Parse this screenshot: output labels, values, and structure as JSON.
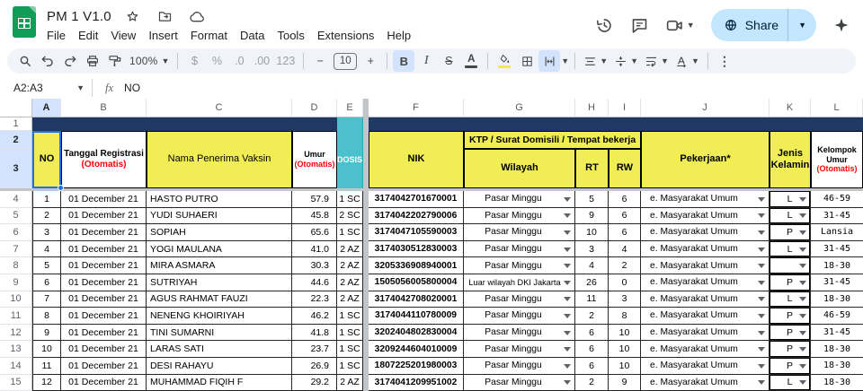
{
  "header": {
    "title": "PM 1 V1.0",
    "menus": [
      "File",
      "Edit",
      "View",
      "Insert",
      "Format",
      "Data",
      "Tools",
      "Extensions",
      "Help"
    ],
    "share_label": "Share"
  },
  "toolbar": {
    "zoom_level": "100%",
    "currency_label": "$",
    "percent_label": "%",
    "decimal_decrease_label": ".0",
    "decimal_increase_label": ".00",
    "number_format_label": "123",
    "minus_label": "−",
    "font_size": "10",
    "plus_label": "+",
    "bold_label": "B",
    "italic_label": "I",
    "strikethrough_label": "S",
    "text_color_label": "A",
    "more_label": "⋮"
  },
  "formula_bar": {
    "cell_reference": "A2:A3",
    "fx_label": "fx",
    "formula_value": "NO"
  },
  "sheet": {
    "column_letters": [
      "A",
      "B",
      "C",
      "D",
      "E",
      "F",
      "G",
      "H",
      "I",
      "J",
      "K",
      "L"
    ],
    "frozen_row_numbers": [
      "1",
      "2",
      "3"
    ],
    "headers": {
      "no": "NO",
      "tanggal_registrasi": "Tanggal Registrasi",
      "tanggal_registrasi_note": "(Otomatis)",
      "nama_penerima_vaksin": "Nama Penerima Vaksin",
      "umur": "Umur",
      "umur_note": "(Otomatis)",
      "dosis": "DOSIS",
      "nik": "NIK",
      "ktp_group": "KTP / Surat Domisili / Tempat bekerja",
      "wilayah": "Wilayah",
      "rt": "RT",
      "rw": "RW",
      "pekerjaan": "Pekerjaan*",
      "jenis_kelamin": "Jenis Kelamin",
      "kelompok_umur": "Kelompok Umur",
      "kelompok_umur_note": "(Otomatis)"
    },
    "rows": [
      {
        "row_number": "4",
        "no": "1",
        "tanggal": "01 December 21",
        "nama": "HASTO PUTRO",
        "umur": "57.9",
        "dosis": "1 SC",
        "nik": "3174042701670001",
        "wilayah": "Pasar Minggu",
        "rt": "5",
        "rw": "6",
        "pekerjaan": "e. Masyarakat Umum",
        "jenis_kelamin": "L",
        "kelompok_umur": "46-59"
      },
      {
        "row_number": "5",
        "no": "2",
        "tanggal": "01 December 21",
        "nama": "YUDI SUHAERI",
        "umur": "45.8",
        "dosis": "2 SC",
        "nik": "3174042202790006",
        "wilayah": "Pasar Minggu",
        "rt": "9",
        "rw": "6",
        "pekerjaan": "e. Masyarakat Umum",
        "jenis_kelamin": "L",
        "kelompok_umur": "31-45"
      },
      {
        "row_number": "6",
        "no": "3",
        "tanggal": "01 December 21",
        "nama": "SOPIAH",
        "umur": "65.6",
        "dosis": "1 SC",
        "nik": "3174047105590003",
        "wilayah": "Pasar Minggu",
        "rt": "10",
        "rw": "6",
        "pekerjaan": "e. Masyarakat Umum",
        "jenis_kelamin": "P",
        "kelompok_umur": "Lansia"
      },
      {
        "row_number": "7",
        "no": "4",
        "tanggal": "01 December 21",
        "nama": "YOGI MAULANA",
        "umur": "41.0",
        "dosis": "2 AZ",
        "nik": "3174030512830003",
        "wilayah": "Pasar Minggu",
        "rt": "3",
        "rw": "4",
        "pekerjaan": "e. Masyarakat Umum",
        "jenis_kelamin": "L",
        "kelompok_umur": "31-45"
      },
      {
        "row_number": "8",
        "no": "5",
        "tanggal": "01 December 21",
        "nama": "MIRA ASMARA",
        "umur": "30.3",
        "dosis": "2 AZ",
        "nik": "3205336908940001",
        "wilayah": "Pasar Minggu",
        "rt": "4",
        "rw": "2",
        "pekerjaan": "e. Masyarakat Umum",
        "jenis_kelamin": "",
        "kelompok_umur": "18-30"
      },
      {
        "row_number": "9",
        "no": "6",
        "tanggal": "01 December 21",
        "nama": "SUTRIYAH",
        "umur": "44.6",
        "dosis": "2 AZ",
        "nik": "1505056005800004",
        "wilayah": "Luar wilayah DKI Jakarta",
        "rt": "26",
        "rw": "0",
        "pekerjaan": "e. Masyarakat Umum",
        "jenis_kelamin": "P",
        "kelompok_umur": "31-45"
      },
      {
        "row_number": "10",
        "no": "7",
        "tanggal": "01 December 21",
        "nama": "AGUS RAHMAT FAUZI",
        "umur": "22.3",
        "dosis": "2 AZ",
        "nik": "3174042708020001",
        "wilayah": "Pasar Minggu",
        "rt": "11",
        "rw": "3",
        "pekerjaan": "e. Masyarakat Umum",
        "jenis_kelamin": "L",
        "kelompok_umur": "18-30"
      },
      {
        "row_number": "11",
        "no": "8",
        "tanggal": "01 December 21",
        "nama": "NENENG KHOIRIYAH",
        "umur": "46.2",
        "dosis": "1 SC",
        "nik": "3174044110780009",
        "wilayah": "Pasar Minggu",
        "rt": "2",
        "rw": "8",
        "pekerjaan": "e. Masyarakat Umum",
        "jenis_kelamin": "P",
        "kelompok_umur": "46-59"
      },
      {
        "row_number": "12",
        "no": "9",
        "tanggal": "01 December 21",
        "nama": "TINI SUMARNI",
        "umur": "41.8",
        "dosis": "1 SC",
        "nik": "3202404802830004",
        "wilayah": "Pasar Minggu",
        "rt": "6",
        "rw": "10",
        "pekerjaan": "e. Masyarakat Umum",
        "jenis_kelamin": "P",
        "kelompok_umur": "31-45"
      },
      {
        "row_number": "13",
        "no": "10",
        "tanggal": "01 December 21",
        "nama": "LARAS SATI",
        "umur": "23.7",
        "dosis": "1 SC",
        "nik": "3209244604010009",
        "wilayah": "Pasar Minggu",
        "rt": "6",
        "rw": "10",
        "pekerjaan": "e. Masyarakat Umum",
        "jenis_kelamin": "P",
        "kelompok_umur": "18-30"
      },
      {
        "row_number": "14",
        "no": "11",
        "tanggal": "01 December 21",
        "nama": "DESI RAHAYU",
        "umur": "26.9",
        "dosis": "1 SC",
        "nik": "1807225201980003",
        "wilayah": "Pasar Minggu",
        "rt": "6",
        "rw": "10",
        "pekerjaan": "e. Masyarakat Umum",
        "jenis_kelamin": "P",
        "kelompok_umur": "18-30"
      },
      {
        "row_number": "15",
        "no": "12",
        "tanggal": "01 December 21",
        "nama": "MUHAMMAD FIQIH F",
        "umur": "29.2",
        "dosis": "2 AZ",
        "nik": "3174041209951002",
        "wilayah": "Pasar Minggu",
        "rt": "2",
        "rw": "9",
        "pekerjaan": "e. Masyarakat Umum",
        "jenis_kelamin": "L",
        "kelompok_umur": "18-30"
      }
    ]
  },
  "colors": {
    "navy_band": "#1f3864",
    "teal_dosis": "#4cc0cd",
    "header_yellow": "#f1ee55",
    "note_red": "#fe0000",
    "selection_blue": "#1a73e8",
    "share_pill": "#c2e7ff"
  }
}
